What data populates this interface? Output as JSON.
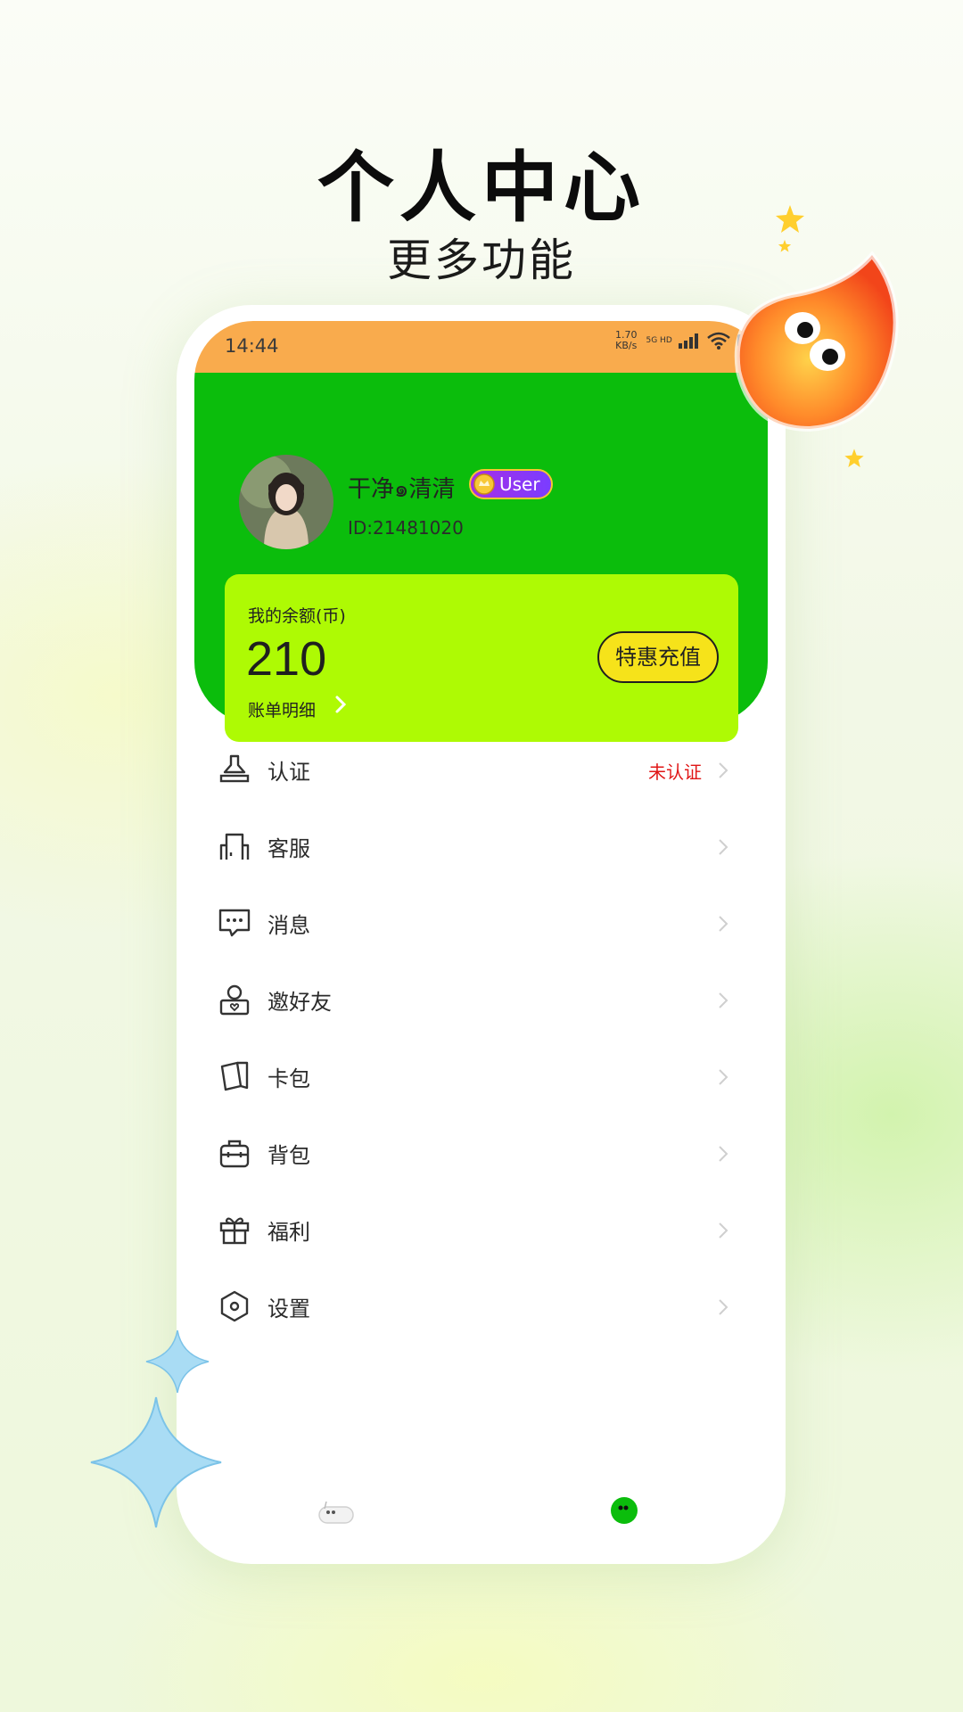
{
  "hero": {
    "title": "个人中心",
    "subtitle": "更多功能"
  },
  "status_bar": {
    "time": "14:44",
    "net_speed_value": "1.70",
    "net_speed_unit": "KB/s",
    "network": "5G HD"
  },
  "profile": {
    "username": "干净๑清清",
    "badge": "User",
    "user_id": "ID:21481020"
  },
  "balance": {
    "label": "我的余额(币)",
    "value": "210",
    "bill_link": "账单明细",
    "recharge_button": "特惠充值"
  },
  "menu": {
    "items": [
      {
        "label": "认证",
        "icon": "stamp-icon",
        "status": "未认证"
      },
      {
        "label": "客服",
        "icon": "headset-icon"
      },
      {
        "label": "消息",
        "icon": "message-icon"
      },
      {
        "label": "邀好友",
        "icon": "invite-icon"
      },
      {
        "label": "卡包",
        "icon": "cards-icon"
      },
      {
        "label": "背包",
        "icon": "backpack-icon"
      },
      {
        "label": "福利",
        "icon": "gift-icon"
      },
      {
        "label": "设置",
        "icon": "settings-icon"
      }
    ]
  },
  "colors": {
    "status_bar": "#f9ab4d",
    "header": "#0bbd0c",
    "balance_card": "#aefa04",
    "recharge_button": "#f6e31a",
    "unverified_text": "#e01616"
  }
}
